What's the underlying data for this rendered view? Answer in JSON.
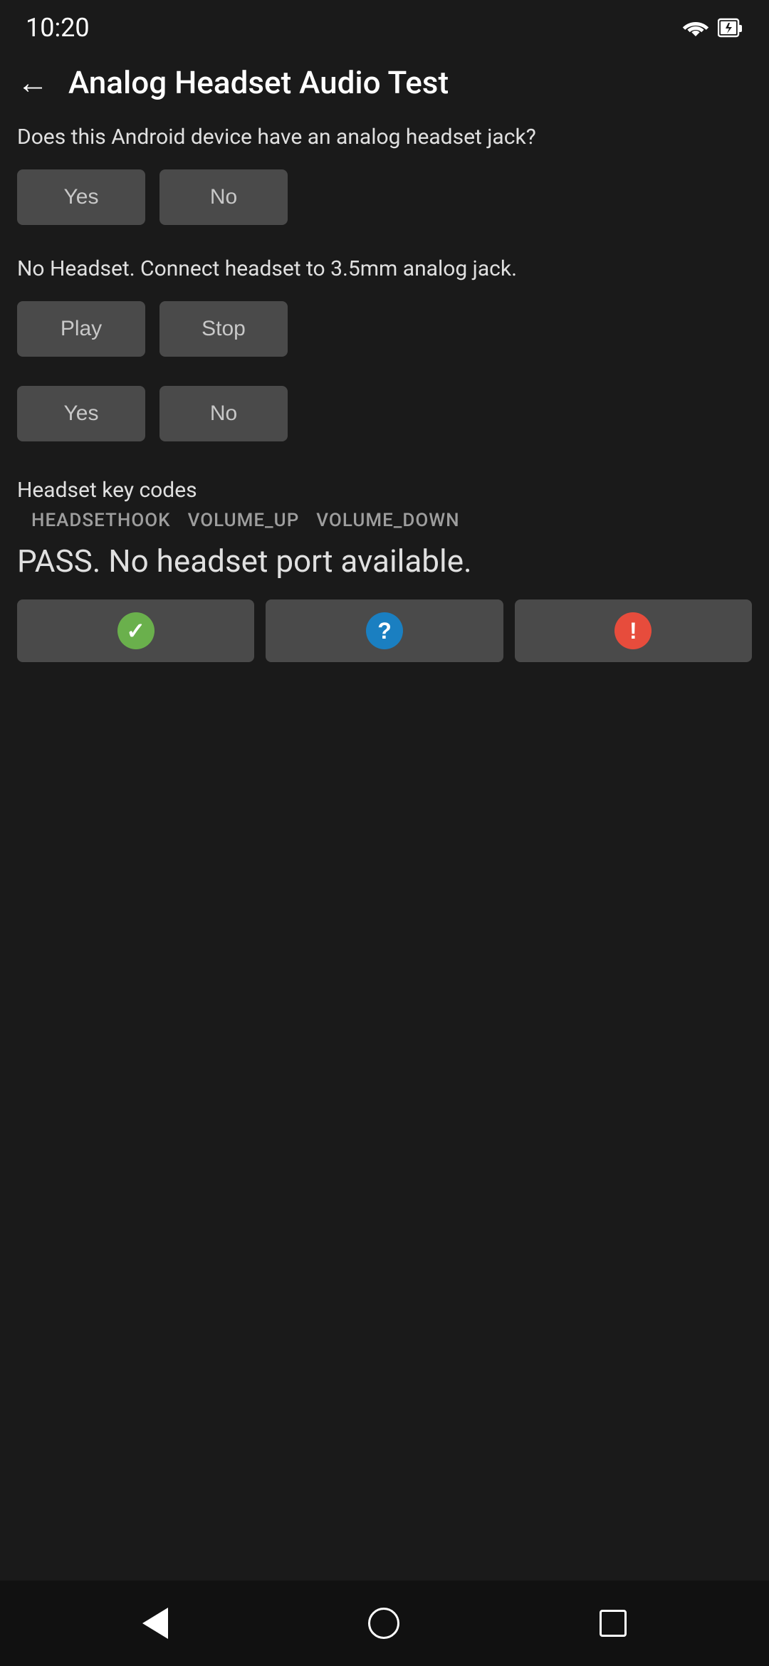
{
  "statusBar": {
    "time": "10:20"
  },
  "toolbar": {
    "title": "Analog Headset Audio Test",
    "backLabel": "←"
  },
  "section1": {
    "question": "Does this Android device have an analog headset jack?",
    "yesLabel": "Yes",
    "noLabel": "No"
  },
  "section2": {
    "info": "No Headset. Connect headset to 3.5mm analog jack.",
    "playLabel": "Play",
    "stopLabel": "Stop"
  },
  "section3": {
    "yesLabel": "Yes",
    "noLabel": "No"
  },
  "section4": {
    "sectionLabel": "Headset key codes",
    "keyCodes": [
      "HEADSETHOOK",
      "VOLUME_UP",
      "VOLUME_DOWN"
    ],
    "passText": "PASS. No headset port available."
  },
  "resultButtons": {
    "passIcon": "✓",
    "infoIcon": "?",
    "failIcon": "!"
  },
  "navBar": {}
}
